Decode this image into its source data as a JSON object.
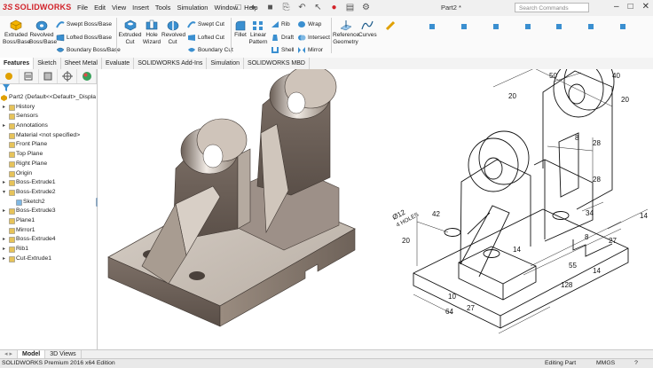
{
  "app": {
    "logo_text": "SOLIDWORKS",
    "logo_prefix": "3S",
    "doc_title": "Part2 *"
  },
  "menu": [
    "File",
    "Edit",
    "View",
    "Insert",
    "Tools",
    "Simulation",
    "Window",
    "Help"
  ],
  "search": {
    "placeholder": "Search Commands"
  },
  "ribbon": {
    "extruded_boss": "Extruded Boss/Base",
    "revolved_boss": "Revolved Boss/Base",
    "swept_boss": "Swept Boss/Base",
    "lofted_boss": "Lofted Boss/Base",
    "boundary_boss": "Boundary Boss/Base",
    "extruded_cut": "Extruded Cut",
    "hole_wizard": "Hole Wizard",
    "revolved_cut": "Revolved Cut",
    "swept_cut": "Swept Cut",
    "lofted_cut": "Lofted Cut",
    "boundary_cut": "Boundary Cut",
    "fillet": "Fillet",
    "linear_pattern": "Linear Pattern",
    "rib": "Rib",
    "draft": "Draft",
    "shell": "Shell",
    "wrap": "Wrap",
    "intersect": "Intersect",
    "mirror": "Mirror",
    "reference_geometry": "Reference Geometry",
    "curves": "Curves"
  },
  "tabs": [
    "Features",
    "Sketch",
    "Sheet Metal",
    "Evaluate",
    "SOLIDWORKS Add-Ins",
    "Simulation",
    "SOLIDWORKS MBD"
  ],
  "tree": {
    "root": "Part2  (Default<<Default>_Displa",
    "items": [
      {
        "label": "History",
        "arrow": "▸",
        "indent": false
      },
      {
        "label": "Sensors",
        "arrow": "",
        "indent": false
      },
      {
        "label": "Annotations",
        "arrow": "▸",
        "indent": false
      },
      {
        "label": "Material <not specified>",
        "arrow": "",
        "indent": false
      },
      {
        "label": "Front Plane",
        "arrow": "",
        "indent": false
      },
      {
        "label": "Top Plane",
        "arrow": "",
        "indent": false
      },
      {
        "label": "Right Plane",
        "arrow": "",
        "indent": false
      },
      {
        "label": "Origin",
        "arrow": "",
        "indent": false
      },
      {
        "label": "Boss-Extrude1",
        "arrow": "▸",
        "indent": false
      },
      {
        "label": "Boss-Extrude2",
        "arrow": "▾",
        "indent": false
      },
      {
        "label": "Sketch2",
        "arrow": "",
        "indent": true
      },
      {
        "label": "Boss-Extrude3",
        "arrow": "▸",
        "indent": false
      },
      {
        "label": "Plane1",
        "arrow": "",
        "indent": false
      },
      {
        "label": "Mirror1",
        "arrow": "",
        "indent": false
      },
      {
        "label": "Boss-Extrude4",
        "arrow": "▸",
        "indent": false
      },
      {
        "label": "Rib1",
        "arrow": "▸",
        "indent": false
      },
      {
        "label": "Cut-Extrude1",
        "arrow": "▸",
        "indent": false
      }
    ]
  },
  "drawing": {
    "dims": {
      "d20_top": "20",
      "d40": "40",
      "d20_right": "20",
      "d50": "50",
      "d20_left": "20",
      "d8_a": "8",
      "d28_a": "28",
      "d28_b": "28",
      "d34": "34",
      "d14_right": "14",
      "d8_b": "8",
      "d27_right": "27",
      "d12": "Ø12",
      "holes": "4 HOLES",
      "d42": "42",
      "d20_base": "20",
      "d14_hole": "14",
      "d55": "55",
      "d14_b": "14",
      "d128": "128",
      "d10": "10",
      "d27_bottom": "27",
      "d64": "64"
    }
  },
  "bottom_tabs": [
    "Model",
    "3D Views"
  ],
  "status": {
    "edition": "SOLIDWORKS Premium 2016 x64 Edition",
    "mode": "Editing Part",
    "units": "MMGS",
    "help": "?"
  },
  "colors": {
    "brand_red": "#d2232a",
    "part_shade": "#8a7d72",
    "part_light": "#cfc6bd"
  }
}
